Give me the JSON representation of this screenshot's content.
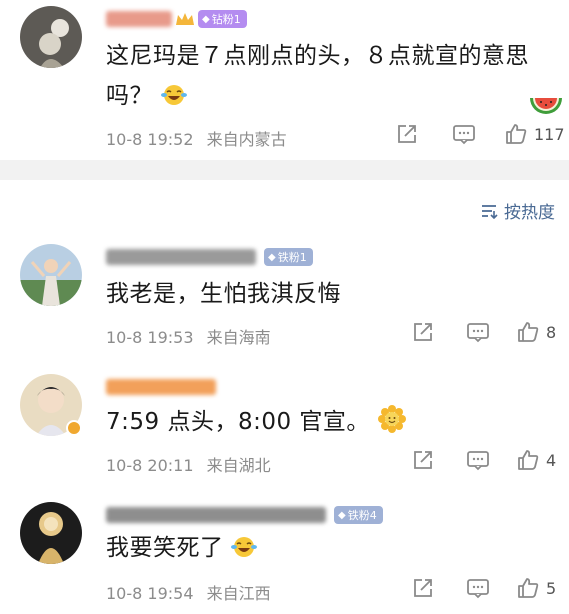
{
  "sort": {
    "label": "按热度",
    "icon": "sort-icon"
  },
  "comments": [
    {
      "badge": "钻粉1",
      "text_line1": "这尼玛是７点刚点的头，８点就宣的意思",
      "text_line2": "吗？",
      "text_emoji": "laugh-cry-emoji",
      "sticker": "watermelon-icon",
      "date": "10-8 19:52",
      "location": "来自内蒙古",
      "like_count": "117",
      "badge_color": "#b48cf0"
    },
    {
      "badge": "铁粉1",
      "text_line1": "我老是，生怕我淇反悔",
      "date": "10-8 19:53",
      "location": "来自海南",
      "like_count": "8",
      "badge_color": "#9fb1d6"
    },
    {
      "badge": "",
      "text_line1": "7:59 点头，8:00 官宣。",
      "text_emoji": "sunflower-emoji",
      "date": "10-8 20:11",
      "location": "来自湖北",
      "like_count": "4"
    },
    {
      "badge": "铁粉4",
      "text_line1": "我要笑死了",
      "text_emoji": "laugh-cry-emoji",
      "date": "10-8 19:54",
      "location": "来自江西",
      "like_count": "5",
      "badge_color": "#9fb1d6"
    }
  ]
}
